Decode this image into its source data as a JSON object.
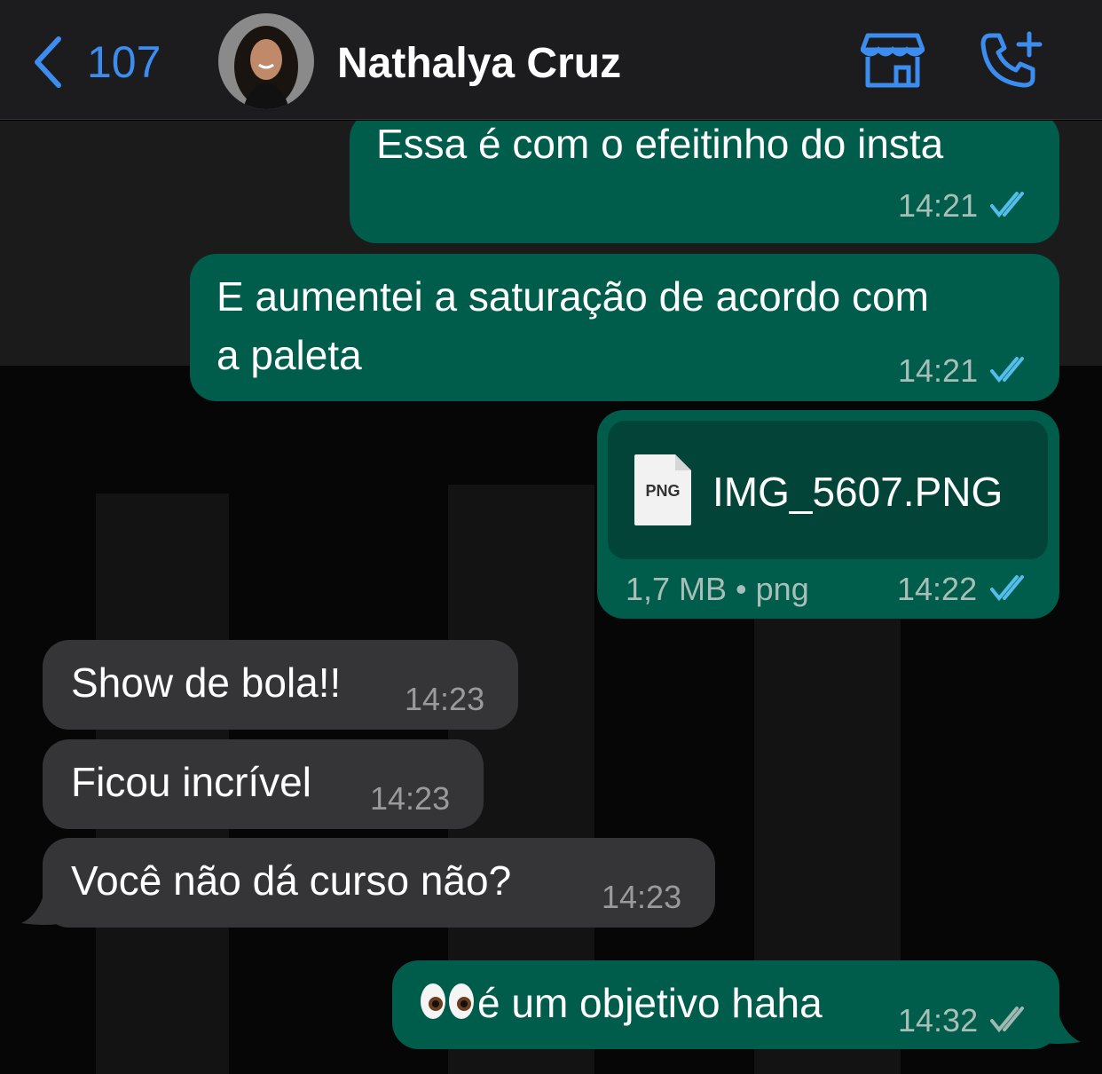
{
  "header": {
    "unread_count": "107",
    "contact_name": "Nathalya Cruz"
  },
  "messages": [
    {
      "direction": "out",
      "text": "Essa é com o efeitinho do insta",
      "time": "14:21",
      "status": "read"
    },
    {
      "direction": "out",
      "text_line1": "E aumentei a saturação de acordo com",
      "text_line2": "a paleta",
      "time": "14:21",
      "status": "read"
    },
    {
      "direction": "out",
      "type": "file",
      "file_badge": "PNG",
      "file_name": "IMG_5607.PNG",
      "file_meta": "1,7 MB • png",
      "time": "14:22",
      "status": "read"
    },
    {
      "direction": "in",
      "text": "Show de bola!!",
      "time": "14:23"
    },
    {
      "direction": "in",
      "text": "Ficou incrível",
      "time": "14:23"
    },
    {
      "direction": "in",
      "text": "Você não dá curso não?",
      "time": "14:23"
    },
    {
      "direction": "out",
      "emoji": "👀",
      "text": "é um objetivo haha",
      "time": "14:32",
      "status": "delivered"
    }
  ],
  "colors": {
    "accent": "#3b8df0",
    "outgoing_bubble": "#005c4b",
    "incoming_bubble": "#353537",
    "read_ticks": "#53bdeb",
    "delivered_ticks": "#9fb8b2"
  },
  "icons": {
    "back": "chevron-left-icon",
    "store": "storefront-icon",
    "call": "phone-add-icon",
    "read": "double-check-icon"
  }
}
